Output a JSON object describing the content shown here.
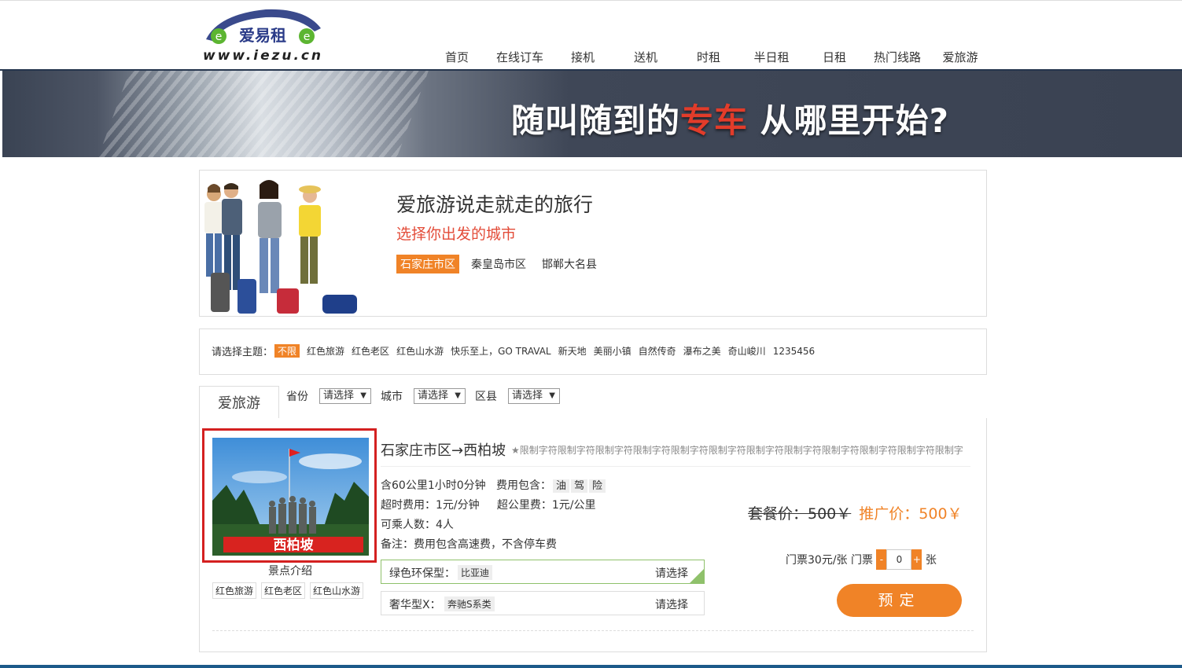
{
  "brand": {
    "name": "爱易租",
    "url": "www.iezu.cn"
  },
  "nav": [
    "首页",
    "在线订车",
    "接机",
    "送机",
    "时租",
    "半日租",
    "日租",
    "热门线路",
    "爱旅游"
  ],
  "banner": {
    "slogan_pre": "随叫随到的",
    "slogan_hl": "专车",
    "slogan_post": " 从哪里开始?"
  },
  "intro": {
    "title": "爱旅游说走就走的旅行",
    "subtitle": "选择你出发的城市",
    "cities": [
      "石家庄市区",
      "秦皇岛市区",
      "邯郸大名县"
    ],
    "active_city": "石家庄市区"
  },
  "themes": {
    "label": "请选择主题：",
    "items": [
      "不限",
      "红色旅游",
      "红色老区",
      "红色山水游",
      "快乐至上，GO TRAVAL",
      "新天地",
      "美丽小镇",
      "自然传奇",
      "瀑布之美",
      "奇山峻川",
      "1235456"
    ]
  },
  "tab": "爱旅游",
  "filters": {
    "province_label": "省份",
    "city_label": "城市",
    "district_label": "区县",
    "placeholder": "请选择"
  },
  "route": {
    "title": "石家庄市区→西柏坡",
    "desc": "★限制字符限制字符限制字符限制字符限制字符限制字符限制字符限制字符限制字符限制字符限制字符限制字",
    "photo_caption": "西柏坡",
    "spot_label": "景点介绍",
    "spot_tags": [
      "红色旅游",
      "红色老区",
      "红色山水游"
    ],
    "line1": "含60公里1小时0分钟",
    "fee_label": "费用包含：",
    "fee_items": [
      "油",
      "驾",
      "险"
    ],
    "line2a": "超时费用：1元/分钟",
    "line2b": "超公里费：1元/公里",
    "line3": "可乘人数：4人",
    "line4": "备注：费用包含高速费，不含停车费",
    "options": [
      {
        "label": "绿色环保型：",
        "value": "比亚迪",
        "pick": "请选择"
      },
      {
        "label": "奢华型X：",
        "value": "奔驰S系类",
        "pick": "请选择"
      }
    ],
    "price_old": "套餐价：500￥",
    "price_new": "推广价：500￥",
    "ticket_text": "门票30元/张 门票",
    "ticket_minus": "-",
    "ticket_count": "0",
    "ticket_plus": "+",
    "ticket_unit": "张",
    "book_label": "预定"
  }
}
